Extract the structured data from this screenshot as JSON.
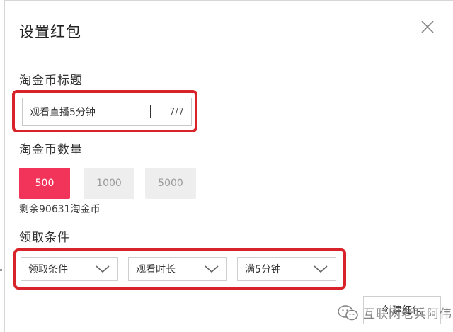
{
  "dialog": {
    "title": "设置红包"
  },
  "title_section": {
    "label": "淘金币标题",
    "input_value": "观看直播5分钟",
    "counter": "7/7"
  },
  "amount_section": {
    "label": "淘金币数量",
    "options": [
      "500",
      "1000",
      "5000"
    ],
    "selected": "500",
    "remaining": "剩余90631淘金币"
  },
  "condition_section": {
    "label": "领取条件",
    "selects": [
      {
        "value": "领取条件"
      },
      {
        "value": "观看时长"
      },
      {
        "value": "满5分钟"
      }
    ]
  },
  "footer": {
    "create_label": "创建红包"
  },
  "watermark": {
    "text": "互联网老兵阿伟"
  },
  "colors": {
    "highlight": "#d8232a",
    "active_option": "#f2345a",
    "idle_option": "#eeeeee"
  },
  "icons": {
    "close": "close-icon",
    "dropdown": "chevron-down-icon",
    "watermark": "wechat-icon"
  }
}
